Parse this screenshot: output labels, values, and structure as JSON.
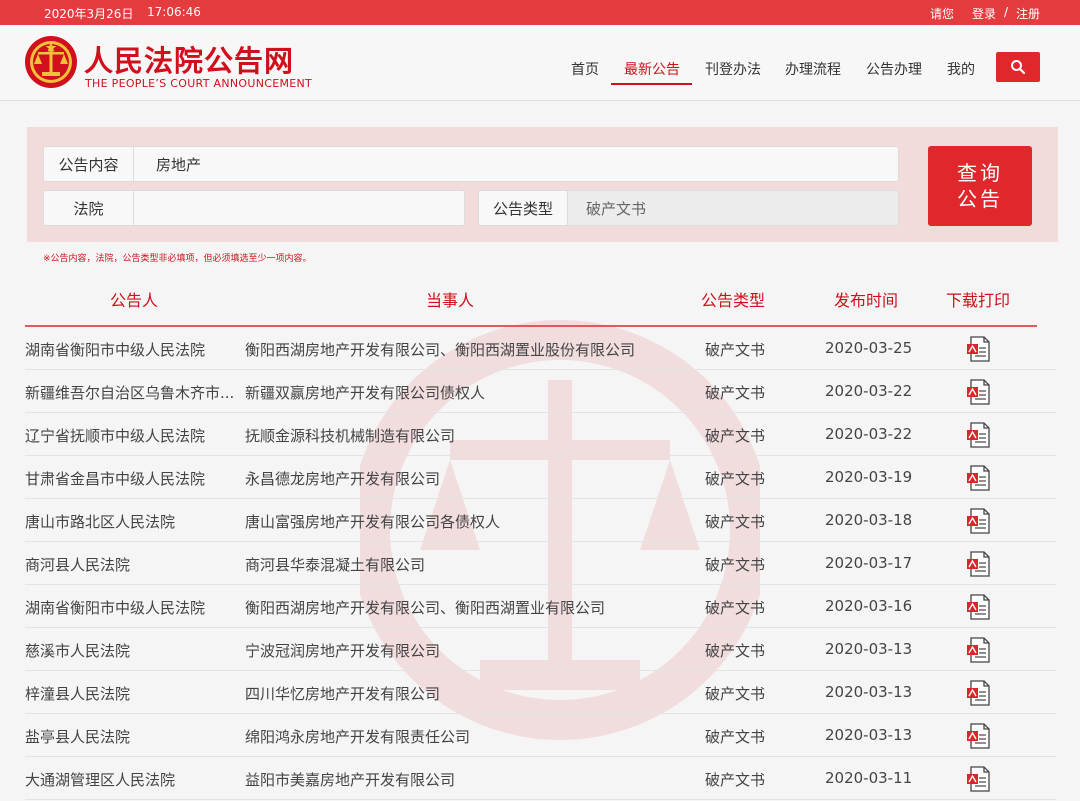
{
  "topbar": {
    "date": "2020年3月26日",
    "time": "17:06:46",
    "greeting": "请您",
    "login": "登录",
    "separator": "/",
    "register": "注册"
  },
  "header": {
    "logo_cn": "人民法院公告网",
    "logo_en": "THE PEOPLE’S COURT ANNOUNCEMENT"
  },
  "nav": {
    "items": [
      {
        "label": "首页"
      },
      {
        "label": "最新公告",
        "active": true
      },
      {
        "label": "刊登办法"
      },
      {
        "label": "办理流程"
      },
      {
        "label": "公告办理"
      },
      {
        "label": "我的"
      }
    ],
    "search_icon": "search-icon"
  },
  "search": {
    "content_label": "公告内容",
    "content_value": "房地产",
    "court_label": "法院",
    "court_value": "",
    "type_label": "公告类型",
    "type_value": "破产文书",
    "query_line1": "查询",
    "query_line2": "公告",
    "note": "※公告内容，法院，公告类型非必填项，但必须填选至少一项内容。"
  },
  "table": {
    "headers": [
      "公告人",
      "当事人",
      "公告类型",
      "发布时间",
      "下载打印"
    ],
    "rows": [
      {
        "court": "湖南省衡阳市中级人民法院",
        "party": "衡阳西湖房地产开发有限公司、衡阳西湖置业股份有限公司",
        "type": "破产文书",
        "date": "2020-03-25"
      },
      {
        "court": "新疆维吾尔自治区乌鲁木齐市...",
        "party": "新疆双赢房地产开发有限公司债权人",
        "type": "破产文书",
        "date": "2020-03-22"
      },
      {
        "court": "辽宁省抚顺市中级人民法院",
        "party": "抚顺金源科技机械制造有限公司",
        "type": "破产文书",
        "date": "2020-03-22"
      },
      {
        "court": "甘肃省金昌市中级人民法院",
        "party": "永昌德龙房地产开发有限公司",
        "type": "破产文书",
        "date": "2020-03-19"
      },
      {
        "court": "唐山市路北区人民法院",
        "party": "唐山富强房地产开发有限公司各债权人",
        "type": "破产文书",
        "date": "2020-03-18"
      },
      {
        "court": "商河县人民法院",
        "party": "商河县华泰混凝土有限公司",
        "type": "破产文书",
        "date": "2020-03-17"
      },
      {
        "court": "湖南省衡阳市中级人民法院",
        "party": "衡阳西湖房地产开发有限公司、衡阳西湖置业有限公司",
        "type": "破产文书",
        "date": "2020-03-16"
      },
      {
        "court": "慈溪市人民法院",
        "party": "宁波冠润房地产开发有限公司",
        "type": "破产文书",
        "date": "2020-03-13"
      },
      {
        "court": "梓潼县人民法院",
        "party": "四川华忆房地产开发有限公司",
        "type": "破产文书",
        "date": "2020-03-13"
      },
      {
        "court": "盐亭县人民法院",
        "party": "绵阳鸿永房地产开发有限责任公司",
        "type": "破产文书",
        "date": "2020-03-13"
      },
      {
        "court": "大通湖管理区人民法院",
        "party": "益阳市美嘉房地产开发有限公司",
        "type": "破产文书",
        "date": "2020-03-11"
      }
    ]
  },
  "colors": {
    "brand_red": "#d0101c",
    "topbar_red": "#e33b3e",
    "button_red": "#e0272b",
    "panel_pink": "#f1dcdb"
  }
}
